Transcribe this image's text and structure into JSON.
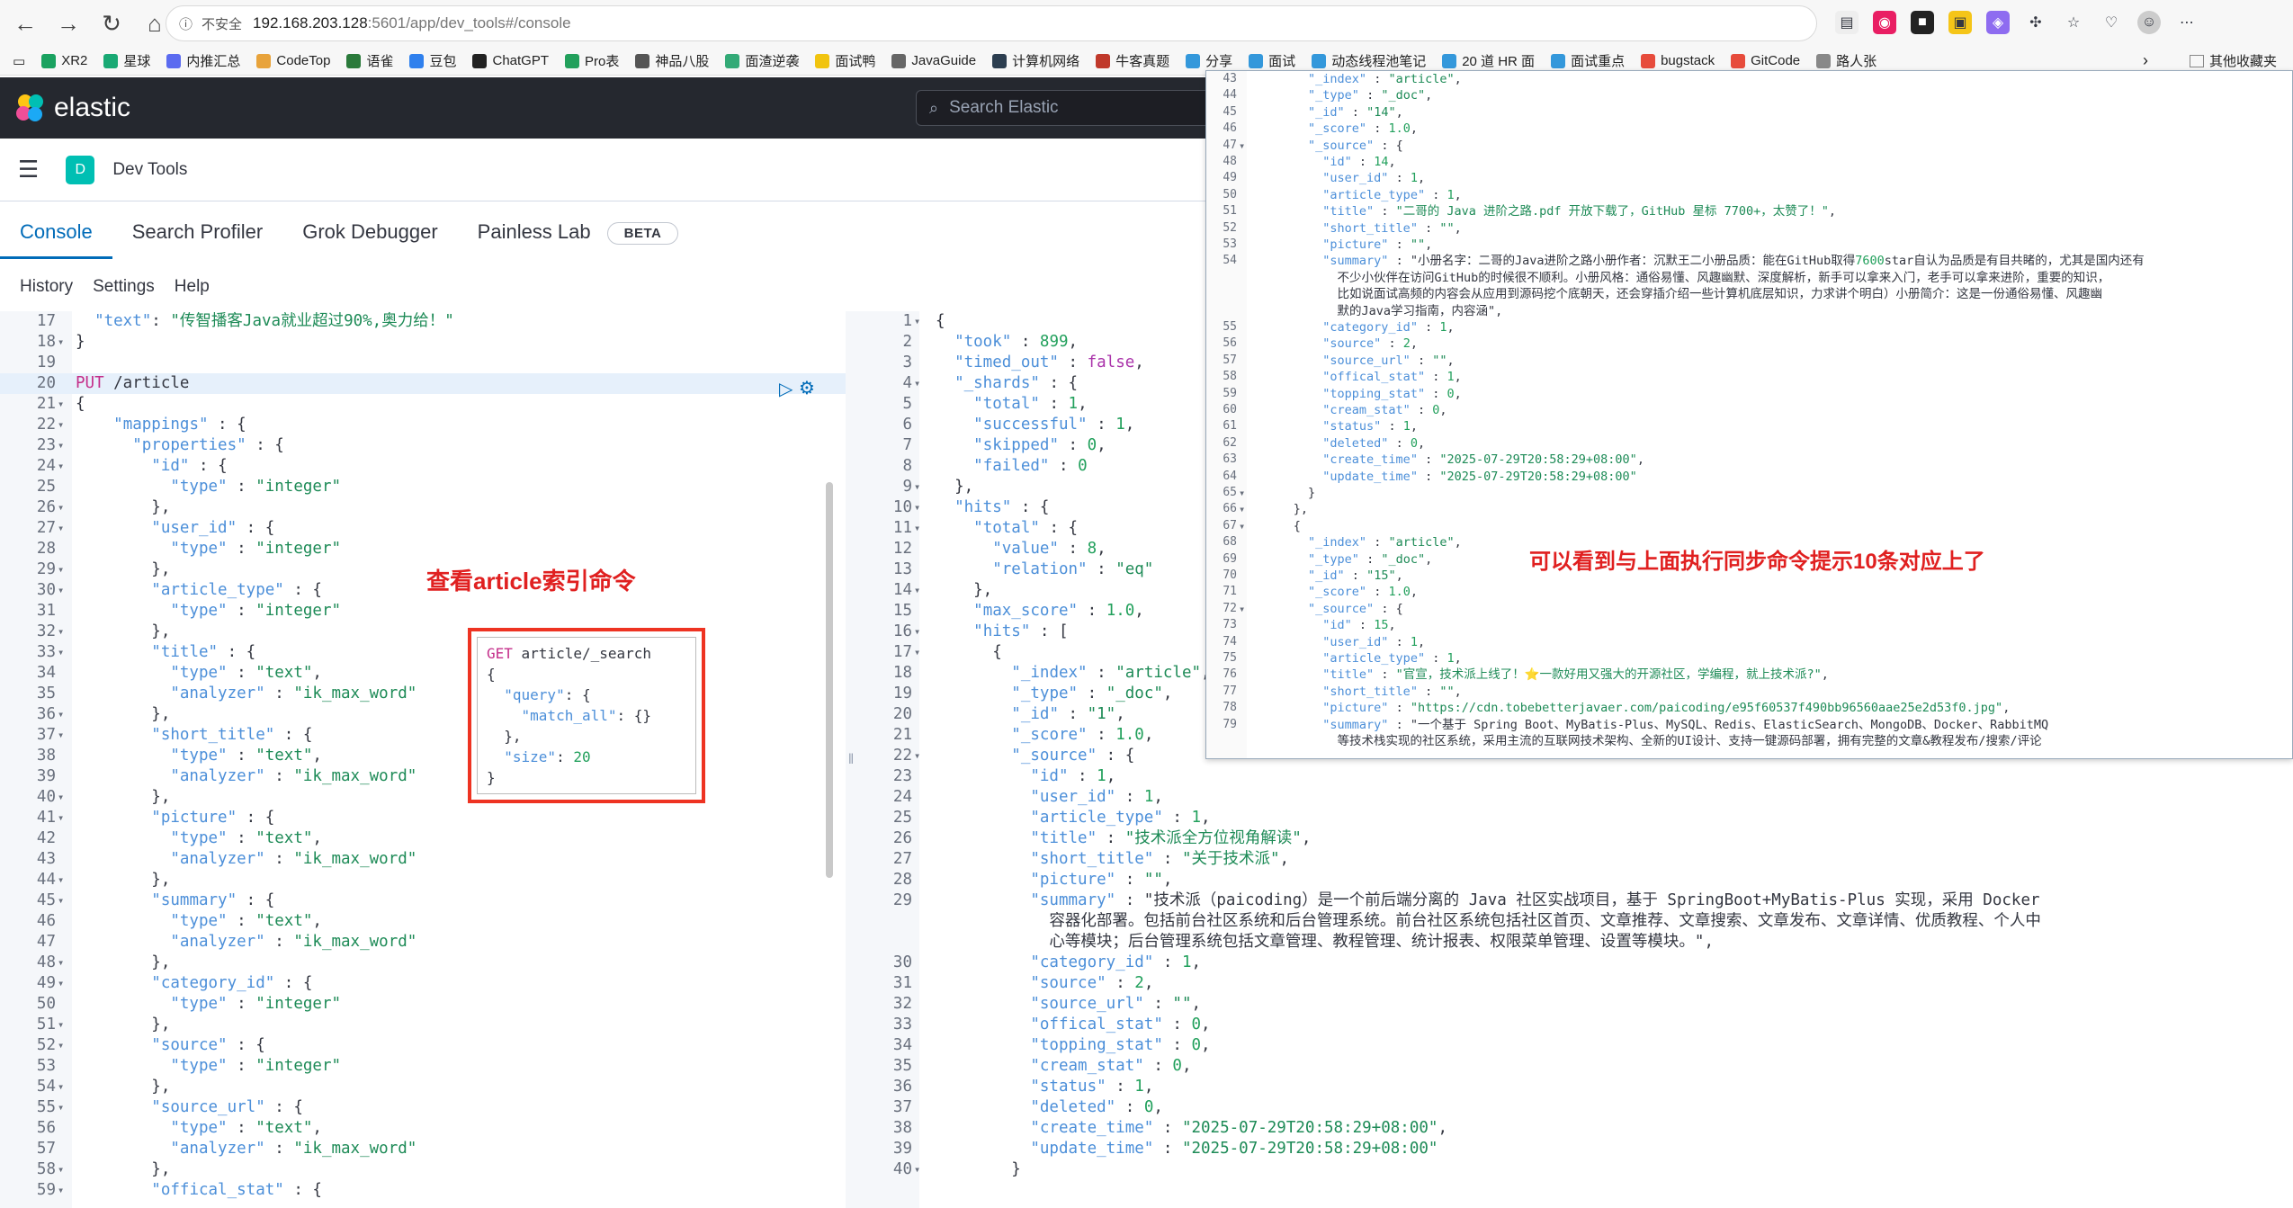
{
  "browser": {
    "insecure_label": "不安全",
    "url_host": "192.168.203.128",
    "url_rest": ":5601/app/dev_tools#/console"
  },
  "bookmarks": [
    {
      "label": "XR2",
      "color": "#1aa260"
    },
    {
      "label": "星球",
      "color": "#19a974"
    },
    {
      "label": "内推汇总",
      "color": "#5b6bf0"
    },
    {
      "label": "CodeTop",
      "color": "#e8a33b"
    },
    {
      "label": "语雀",
      "color": "#2b7a3b"
    },
    {
      "label": "豆包",
      "color": "#2f80ed"
    },
    {
      "label": "ChatGPT",
      "color": "#222"
    },
    {
      "label": "Pro表",
      "color": "#22a05c"
    },
    {
      "label": "神品八股",
      "color": "#555"
    },
    {
      "label": "面渣逆袭",
      "color": "#3a7"
    },
    {
      "label": "面试鸭",
      "color": "#f1c40f"
    },
    {
      "label": "JavaGuide",
      "color": "#666"
    },
    {
      "label": "计算机网络",
      "color": "#2c3e50"
    },
    {
      "label": "牛客真题",
      "color": "#c0392b"
    },
    {
      "label": "分享",
      "color": "#3498db"
    },
    {
      "label": "面试",
      "color": "#3498db"
    },
    {
      "label": "动态线程池笔记",
      "color": "#3498db"
    },
    {
      "label": "20 道 HR 面",
      "color": "#3498db"
    },
    {
      "label": "面试重点",
      "color": "#3498db"
    },
    {
      "label": "bugstack",
      "color": "#e74c3c"
    },
    {
      "label": "GitCode",
      "color": "#e74c3c"
    },
    {
      "label": "路人张",
      "color": "#888"
    }
  ],
  "bookmarks_other": "其他收藏夹",
  "kibana": {
    "brand": "elastic",
    "search_placeholder": "Search Elastic",
    "space_initial": "D",
    "app_title": "Dev Tools"
  },
  "tabs": [
    "Console",
    "Search Profiler",
    "Grok Debugger",
    "Painless Lab"
  ],
  "beta_badge": "BETA",
  "console_menu": [
    "History",
    "Settings",
    "Help"
  ],
  "left_editor": [
    {
      "n": "17",
      "f": "",
      "t": "  \"text\": \"传智播客Java就业超过90%,奥力给！\""
    },
    {
      "n": "18",
      "f": "▾",
      "t": "}"
    },
    {
      "n": "19",
      "f": "",
      "t": ""
    },
    {
      "n": "20",
      "f": "",
      "t": "PUT /article"
    },
    {
      "n": "21",
      "f": "▾",
      "t": "{"
    },
    {
      "n": "22",
      "f": "▾",
      "t": "    \"mappings\" : {"
    },
    {
      "n": "23",
      "f": "▾",
      "t": "      \"properties\" : {"
    },
    {
      "n": "24",
      "f": "▾",
      "t": "        \"id\" : {"
    },
    {
      "n": "25",
      "f": "",
      "t": "          \"type\" : \"integer\""
    },
    {
      "n": "26",
      "f": "▾",
      "t": "        },"
    },
    {
      "n": "27",
      "f": "▾",
      "t": "        \"user_id\" : {"
    },
    {
      "n": "28",
      "f": "",
      "t": "          \"type\" : \"integer\""
    },
    {
      "n": "29",
      "f": "▾",
      "t": "        },"
    },
    {
      "n": "30",
      "f": "▾",
      "t": "        \"article_type\" : {"
    },
    {
      "n": "31",
      "f": "",
      "t": "          \"type\" : \"integer\""
    },
    {
      "n": "32",
      "f": "▾",
      "t": "        },"
    },
    {
      "n": "33",
      "f": "▾",
      "t": "        \"title\" : {"
    },
    {
      "n": "34",
      "f": "",
      "t": "          \"type\" : \"text\","
    },
    {
      "n": "35",
      "f": "",
      "t": "          \"analyzer\" : \"ik_max_word\""
    },
    {
      "n": "36",
      "f": "▾",
      "t": "        },"
    },
    {
      "n": "37",
      "f": "▾",
      "t": "        \"short_title\" : {"
    },
    {
      "n": "38",
      "f": "",
      "t": "          \"type\" : \"text\","
    },
    {
      "n": "39",
      "f": "",
      "t": "          \"analyzer\" : \"ik_max_word\""
    },
    {
      "n": "40",
      "f": "▾",
      "t": "        },"
    },
    {
      "n": "41",
      "f": "▾",
      "t": "        \"picture\" : {"
    },
    {
      "n": "42",
      "f": "",
      "t": "          \"type\" : \"text\","
    },
    {
      "n": "43",
      "f": "",
      "t": "          \"analyzer\" : \"ik_max_word\""
    },
    {
      "n": "44",
      "f": "▾",
      "t": "        },"
    },
    {
      "n": "45",
      "f": "▾",
      "t": "        \"summary\" : {"
    },
    {
      "n": "46",
      "f": "",
      "t": "          \"type\" : \"text\","
    },
    {
      "n": "47",
      "f": "",
      "t": "          \"analyzer\" : \"ik_max_word\""
    },
    {
      "n": "48",
      "f": "▾",
      "t": "        },"
    },
    {
      "n": "49",
      "f": "▾",
      "t": "        \"category_id\" : {"
    },
    {
      "n": "50",
      "f": "",
      "t": "          \"type\" : \"integer\""
    },
    {
      "n": "51",
      "f": "▾",
      "t": "        },"
    },
    {
      "n": "52",
      "f": "▾",
      "t": "        \"source\" : {"
    },
    {
      "n": "53",
      "f": "",
      "t": "          \"type\" : \"integer\""
    },
    {
      "n": "54",
      "f": "▾",
      "t": "        },"
    },
    {
      "n": "55",
      "f": "▾",
      "t": "        \"source_url\" : {"
    },
    {
      "n": "56",
      "f": "",
      "t": "          \"type\" : \"text\","
    },
    {
      "n": "57",
      "f": "",
      "t": "          \"analyzer\" : \"ik_max_word\""
    },
    {
      "n": "58",
      "f": "▾",
      "t": "        },"
    },
    {
      "n": "59",
      "f": "▾",
      "t": "        \"offical_stat\" : {"
    }
  ],
  "right_editor": [
    {
      "n": "1",
      "f": "▾",
      "t": "{"
    },
    {
      "n": "2",
      "f": "",
      "t": "  \"took\" : 899,"
    },
    {
      "n": "3",
      "f": "",
      "t": "  \"timed_out\" : false,"
    },
    {
      "n": "4",
      "f": "▾",
      "t": "  \"_shards\" : {"
    },
    {
      "n": "5",
      "f": "",
      "t": "    \"total\" : 1,"
    },
    {
      "n": "6",
      "f": "",
      "t": "    \"successful\" : 1,"
    },
    {
      "n": "7",
      "f": "",
      "t": "    \"skipped\" : 0,"
    },
    {
      "n": "8",
      "f": "",
      "t": "    \"failed\" : 0"
    },
    {
      "n": "9",
      "f": "▾",
      "t": "  },"
    },
    {
      "n": "10",
      "f": "▾",
      "t": "  \"hits\" : {"
    },
    {
      "n": "11",
      "f": "▾",
      "t": "    \"total\" : {"
    },
    {
      "n": "12",
      "f": "",
      "t": "      \"value\" : 8,"
    },
    {
      "n": "13",
      "f": "",
      "t": "      \"relation\" : \"eq\""
    },
    {
      "n": "14",
      "f": "▾",
      "t": "    },"
    },
    {
      "n": "15",
      "f": "",
      "t": "    \"max_score\" : 1.0,"
    },
    {
      "n": "16",
      "f": "▾",
      "t": "    \"hits\" : ["
    },
    {
      "n": "17",
      "f": "▾",
      "t": "      {"
    },
    {
      "n": "18",
      "f": "",
      "t": "        \"_index\" : \"article\","
    },
    {
      "n": "19",
      "f": "",
      "t": "        \"_type\" : \"_doc\","
    },
    {
      "n": "20",
      "f": "",
      "t": "        \"_id\" : \"1\","
    },
    {
      "n": "21",
      "f": "",
      "t": "        \"_score\" : 1.0,"
    },
    {
      "n": "22",
      "f": "▾",
      "t": "        \"_source\" : {"
    },
    {
      "n": "23",
      "f": "",
      "t": "          \"id\" : 1,"
    },
    {
      "n": "24",
      "f": "",
      "t": "          \"user_id\" : 1,"
    },
    {
      "n": "25",
      "f": "",
      "t": "          \"article_type\" : 1,"
    },
    {
      "n": "26",
      "f": "",
      "t": "          \"title\" : \"技术派全方位视角解读\","
    },
    {
      "n": "27",
      "f": "",
      "t": "          \"short_title\" : \"关于技术派\","
    },
    {
      "n": "28",
      "f": "",
      "t": "          \"picture\" : \"\","
    },
    {
      "n": "29",
      "f": "",
      "t": "          \"summary\" : \"技术派（paicoding）是一个前后端分离的 Java 社区实战项目，基于 SpringBoot+MyBatis-Plus 实现，采用 Docker"
    },
    {
      "n": "",
      "f": "",
      "t": "            容器化部署。包括前台社区系统和后台管理系统。前台社区系统包括社区首页、文章推荐、文章搜索、文章发布、文章详情、优质教程、个人中"
    },
    {
      "n": "",
      "f": "",
      "t": "            心等模块；后台管理系统包括文章管理、教程管理、统计报表、权限菜单管理、设置等模块。\","
    },
    {
      "n": "30",
      "f": "",
      "t": "          \"category_id\" : 1,"
    },
    {
      "n": "31",
      "f": "",
      "t": "          \"source\" : 2,"
    },
    {
      "n": "32",
      "f": "",
      "t": "          \"source_url\" : \"\","
    },
    {
      "n": "33",
      "f": "",
      "t": "          \"offical_stat\" : 0,"
    },
    {
      "n": "34",
      "f": "",
      "t": "          \"topping_stat\" : 0,"
    },
    {
      "n": "35",
      "f": "",
      "t": "          \"cream_stat\" : 0,"
    },
    {
      "n": "36",
      "f": "",
      "t": "          \"status\" : 1,"
    },
    {
      "n": "37",
      "f": "",
      "t": "          \"deleted\" : 0,"
    },
    {
      "n": "38",
      "f": "",
      "t": "          \"create_time\" : \"2025-07-29T20:58:29+08:00\","
    },
    {
      "n": "39",
      "f": "",
      "t": "          \"update_time\" : \"2025-07-29T20:58:29+08:00\""
    },
    {
      "n": "40",
      "f": "▾",
      "t": "        }"
    }
  ],
  "overlay_editor": [
    {
      "n": "43",
      "f": "",
      "t": "        \"_index\" : \"article\","
    },
    {
      "n": "44",
      "f": "",
      "t": "        \"_type\" : \"_doc\","
    },
    {
      "n": "45",
      "f": "",
      "t": "        \"_id\" : \"14\","
    },
    {
      "n": "46",
      "f": "",
      "t": "        \"_score\" : 1.0,"
    },
    {
      "n": "47",
      "f": "▾",
      "t": "        \"_source\" : {"
    },
    {
      "n": "48",
      "f": "",
      "t": "          \"id\" : 14,"
    },
    {
      "n": "49",
      "f": "",
      "t": "          \"user_id\" : 1,"
    },
    {
      "n": "50",
      "f": "",
      "t": "          \"article_type\" : 1,"
    },
    {
      "n": "51",
      "f": "",
      "t": "          \"title\" : \"二哥的 Java 进阶之路.pdf 开放下载了，GitHub 星标 7700+，太赞了！\","
    },
    {
      "n": "52",
      "f": "",
      "t": "          \"short_title\" : \"\","
    },
    {
      "n": "53",
      "f": "",
      "t": "          \"picture\" : \"\","
    },
    {
      "n": "54",
      "f": "",
      "t": "          \"summary\" : \"小册名字：二哥的Java进阶之路小册作者：沉默王二小册品质：能在GitHub取得7600star自认为品质是有目共睹的，尤其是国内还有"
    },
    {
      "n": "",
      "f": "",
      "t": "            不少小伙伴在访问GitHub的时候很不顺利。小册风格：通俗易懂、风趣幽默、深度解析，新手可以拿来入门，老手可以拿来进阶，重要的知识，"
    },
    {
      "n": "",
      "f": "",
      "t": "            比如说面试高频的内容会从应用到源码挖个底朝天，还会穿插介绍一些计算机底层知识，力求讲个明白）小册简介：这是一份通俗易懂、风趣幽"
    },
    {
      "n": "",
      "f": "",
      "t": "            默的Java学习指南，内容涵\","
    },
    {
      "n": "55",
      "f": "",
      "t": "          \"category_id\" : 1,"
    },
    {
      "n": "56",
      "f": "",
      "t": "          \"source\" : 2,"
    },
    {
      "n": "57",
      "f": "",
      "t": "          \"source_url\" : \"\","
    },
    {
      "n": "58",
      "f": "",
      "t": "          \"offical_stat\" : 1,"
    },
    {
      "n": "59",
      "f": "",
      "t": "          \"topping_stat\" : 0,"
    },
    {
      "n": "60",
      "f": "",
      "t": "          \"cream_stat\" : 0,"
    },
    {
      "n": "61",
      "f": "",
      "t": "          \"status\" : 1,"
    },
    {
      "n": "62",
      "f": "",
      "t": "          \"deleted\" : 0,"
    },
    {
      "n": "63",
      "f": "",
      "t": "          \"create_time\" : \"2025-07-29T20:58:29+08:00\","
    },
    {
      "n": "64",
      "f": "",
      "t": "          \"update_time\" : \"2025-07-29T20:58:29+08:00\""
    },
    {
      "n": "65",
      "f": "▾",
      "t": "        }"
    },
    {
      "n": "66",
      "f": "▾",
      "t": "      },"
    },
    {
      "n": "67",
      "f": "▾",
      "t": "      {"
    },
    {
      "n": "68",
      "f": "",
      "t": "        \"_index\" : \"article\","
    },
    {
      "n": "69",
      "f": "",
      "t": "        \"_type\" : \"_doc\","
    },
    {
      "n": "70",
      "f": "",
      "t": "        \"_id\" : \"15\","
    },
    {
      "n": "71",
      "f": "",
      "t": "        \"_score\" : 1.0,"
    },
    {
      "n": "72",
      "f": "▾",
      "t": "        \"_source\" : {"
    },
    {
      "n": "73",
      "f": "",
      "t": "          \"id\" : 15,"
    },
    {
      "n": "74",
      "f": "",
      "t": "          \"user_id\" : 1,"
    },
    {
      "n": "75",
      "f": "",
      "t": "          \"article_type\" : 1,"
    },
    {
      "n": "76",
      "f": "",
      "t": "          \"title\" : \"官宣，技术派上线了！⭐一款好用又强大的开源社区，学编程，就上技术派?\","
    },
    {
      "n": "77",
      "f": "",
      "t": "          \"short_title\" : \"\","
    },
    {
      "n": "78",
      "f": "",
      "t": "          \"picture\" : \"https://cdn.tobebetterjavaer.com/paicoding/e95f60537f490bb96560aae25e2d53f0.jpg\","
    },
    {
      "n": "79",
      "f": "",
      "t": "          \"summary\" : \"一个基于 Spring Boot、MyBatis-Plus、MySQL、Redis、ElasticSearch、MongoDB、Docker、RabbitMQ"
    },
    {
      "n": "",
      "f": "",
      "t": "            等技术栈实现的社区系统，采用主流的互联网技术架构、全新的UI设计、支持一键源码部署，拥有完整的文章&教程发布/搜索/评论"
    }
  ],
  "annotations": {
    "left_label": "查看article索引命令",
    "right_label": "可以看到与上面执行同步命令提示10条对应上了"
  },
  "search_box_lines": [
    "GET article/_search",
    "{",
    "  \"query\": {",
    "    \"match_all\": {}",
    "  },",
    "  \"size\": 20",
    "}"
  ]
}
